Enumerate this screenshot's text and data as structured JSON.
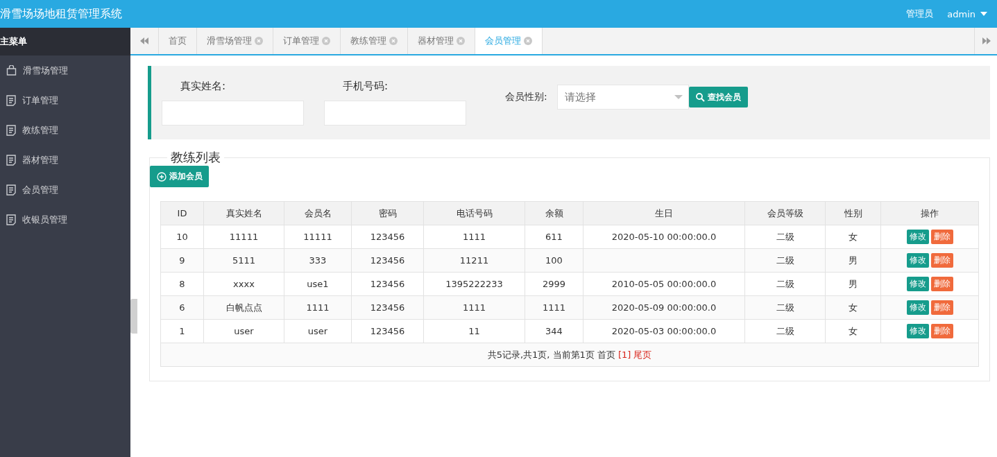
{
  "header": {
    "title": "滑雪场场地租赁管理系统",
    "role": "管理员",
    "user": "admin"
  },
  "sidebar": {
    "title": "主菜单",
    "items": [
      {
        "label": "滑雪场管理",
        "kind": "bag"
      },
      {
        "label": "订单管理",
        "kind": "doc"
      },
      {
        "label": "教练管理",
        "kind": "doc"
      },
      {
        "label": "器材管理",
        "kind": "doc"
      },
      {
        "label": "会员管理",
        "kind": "doc"
      },
      {
        "label": "收银员管理",
        "kind": "doc"
      }
    ]
  },
  "tabs": [
    {
      "label": "首页",
      "closable": false,
      "selected": false
    },
    {
      "label": "滑雪场管理",
      "closable": true,
      "selected": false
    },
    {
      "label": "订单管理",
      "closable": true,
      "selected": false
    },
    {
      "label": "教练管理",
      "closable": true,
      "selected": false
    },
    {
      "label": "器材管理",
      "closable": true,
      "selected": false
    },
    {
      "label": "会员管理",
      "closable": true,
      "selected": true
    }
  ],
  "search": {
    "name_label": "真实姓名:",
    "phone_label": "手机号码:",
    "gender_label": "会员性别:",
    "gender_placeholder": "请选择",
    "button": "查找会员"
  },
  "list": {
    "legend": "教练列表",
    "add_button": "添加会员",
    "columns": [
      "ID",
      "真实姓名",
      "会员名",
      "密码",
      "电话号码",
      "余额",
      "生日",
      "会员等级",
      "性别",
      "操作"
    ],
    "rows": [
      {
        "cells": [
          "10",
          "11111",
          "11111",
          "123456",
          "1111",
          "611",
          "2020-05-10 00:00:00.0",
          "二级",
          "女"
        ],
        "edit": "修改",
        "delete": "删除"
      },
      {
        "cells": [
          "9",
          "5111",
          "333",
          "123456",
          "11211",
          "100",
          "",
          "二级",
          "男"
        ],
        "edit": "修改",
        "delete": "删除"
      },
      {
        "cells": [
          "8",
          "xxxx",
          "use1",
          "123456",
          "1395222233",
          "2999",
          "2010-05-05 00:00:00.0",
          "二级",
          "男"
        ],
        "edit": "修改",
        "delete": "删除"
      },
      {
        "cells": [
          "6",
          "白帆点点",
          "1111",
          "123456",
          "1111",
          "1111",
          "2020-05-09 00:00:00.0",
          "二级",
          "女"
        ],
        "edit": "修改",
        "delete": "删除"
      },
      {
        "cells": [
          "1",
          "user",
          "user",
          "123456",
          "11",
          "344",
          "2020-05-03 00:00:00.0",
          "二级",
          "女"
        ],
        "edit": "修改",
        "delete": "删除"
      }
    ],
    "pager": {
      "summary": "共5记录,共1页, 当前第1页",
      "first": "首页",
      "current": "[1]",
      "last": "尾页"
    }
  }
}
